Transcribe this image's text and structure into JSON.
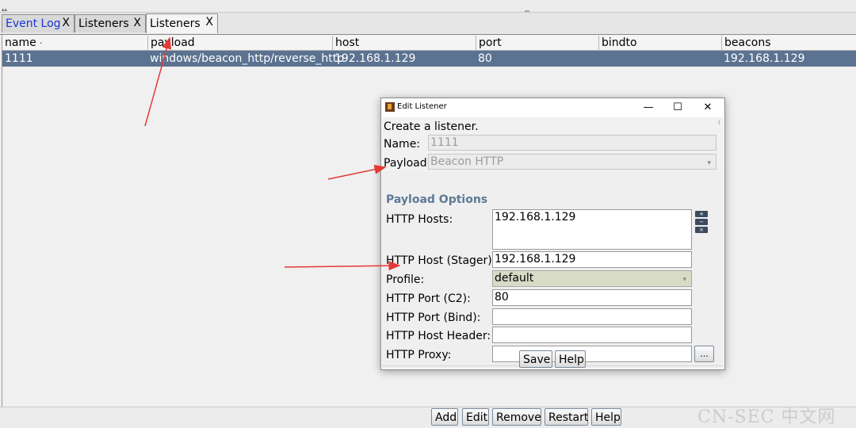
{
  "tabs": [
    {
      "label": "Event Log",
      "close": "X"
    },
    {
      "label": "Listeners",
      "close": "X"
    },
    {
      "label": "Listeners",
      "close": "X"
    }
  ],
  "table": {
    "columns": [
      "name",
      "payload",
      "host",
      "port",
      "bindto",
      "beacons"
    ],
    "sort_indicator": "·",
    "rows": [
      {
        "name": "1111",
        "payload": "windows/beacon_http/reverse_http",
        "host": "192.168.1.129",
        "port": "80",
        "bindto": "",
        "beacons": "192.168.1.129"
      }
    ]
  },
  "bottom_buttons": [
    "Add",
    "Edit",
    "Remove",
    "Restart",
    "Help"
  ],
  "dialog": {
    "title": "Edit Listener",
    "window_controls": {
      "minimize": "—",
      "maximize": "☐",
      "close": "✕"
    },
    "intro": "Create a listener.",
    "name_label": "Name:",
    "name_value": "1111",
    "payload_label": "Payload:",
    "payload_value": "Beacon HTTP",
    "options_title": "Payload Options",
    "fields": {
      "hosts_label": "HTTP Hosts:",
      "hosts_value": "192.168.1.129",
      "stager_label": "HTTP Host (Stager):",
      "stager_value": "192.168.1.129",
      "profile_label": "Profile:",
      "profile_value": "default",
      "port_c2_label": "HTTP Port (C2):",
      "port_c2_value": "80",
      "port_bind_label": "HTTP Port (Bind):",
      "port_bind_value": "",
      "host_header_label": "HTTP Host Header:",
      "host_header_value": "",
      "proxy_label": "HTTP Proxy:",
      "proxy_value": "",
      "proxy_button": "..."
    },
    "hosts_buttons": [
      "+",
      "−",
      "×"
    ],
    "buttons": {
      "save": "Save",
      "help": "Help"
    }
  },
  "watermark": "CN-SEC 中文网",
  "colors": {
    "selection_row": "#5b7391",
    "options_title": "#5d7a96",
    "annotation_arrow": "#e53935",
    "event_log_tab": "#1a35d6"
  }
}
